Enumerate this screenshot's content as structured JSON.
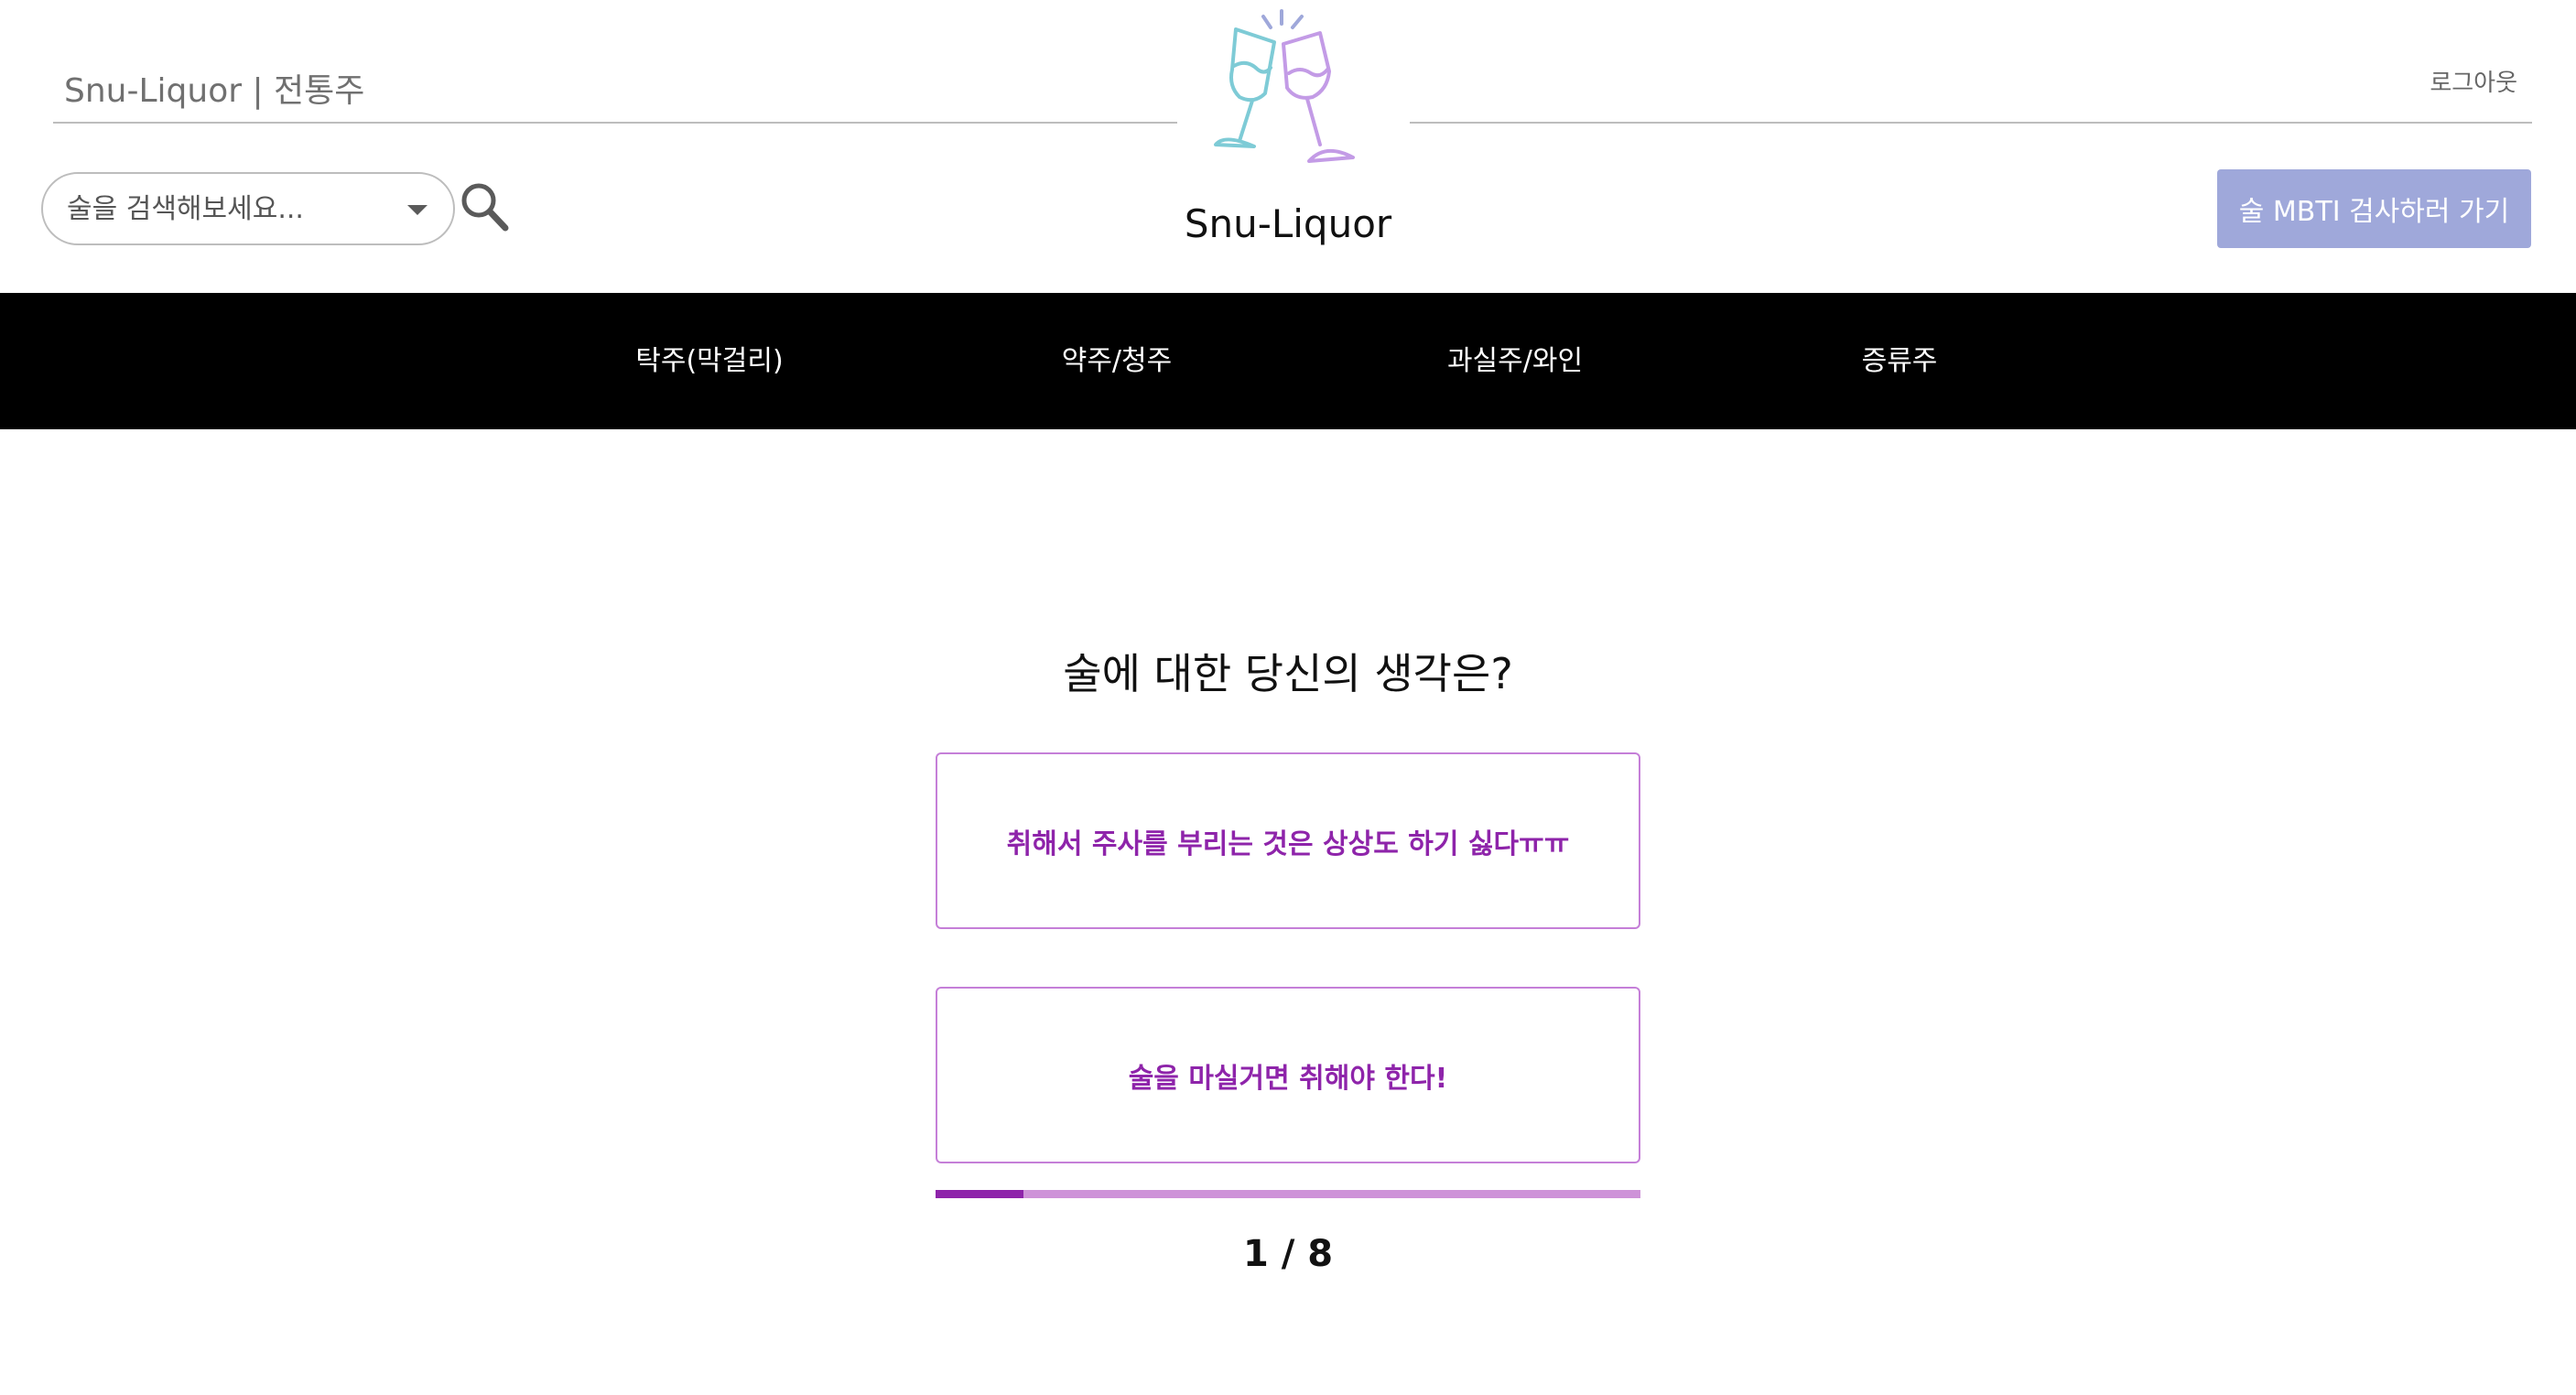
{
  "header": {
    "brand_text": "Snu-Liquor | 전통주",
    "logout_label": "로그아웃",
    "logo_text": "Snu-Liquor"
  },
  "search": {
    "placeholder": "술을 검색해보세요..."
  },
  "mbti_button_label": "술 MBTI 검사하러 가기",
  "nav": {
    "items": [
      {
        "label": "탁주(막걸리)"
      },
      {
        "label": "약주/청주"
      },
      {
        "label": "과실주/와인"
      },
      {
        "label": "증류주"
      }
    ]
  },
  "quiz": {
    "question": "술에 대한 당신의 생각은?",
    "options": [
      {
        "label": "취해서 주사를 부리는 것은 상상도 하기 싫다ㅠㅠ"
      },
      {
        "label": "술을 마실거면 취해야 한다!"
      }
    ],
    "progress": {
      "current": 1,
      "total": 8,
      "fraction": 0.125,
      "text": "1 / 8"
    }
  },
  "icons": {
    "logo": "cheers-glasses-icon",
    "search": "search-icon",
    "dropdown": "chevron-down-icon"
  },
  "colors": {
    "nav_background": "#000000",
    "mbti_button": "#9fa8da",
    "option_border": "#c57fd8",
    "option_text": "#8e24aa",
    "progress_fill": "#8e24aa",
    "progress_track": "#ce93d8",
    "logo_left_glass": "#7ecbd6",
    "logo_right_glass": "#c39be6"
  }
}
